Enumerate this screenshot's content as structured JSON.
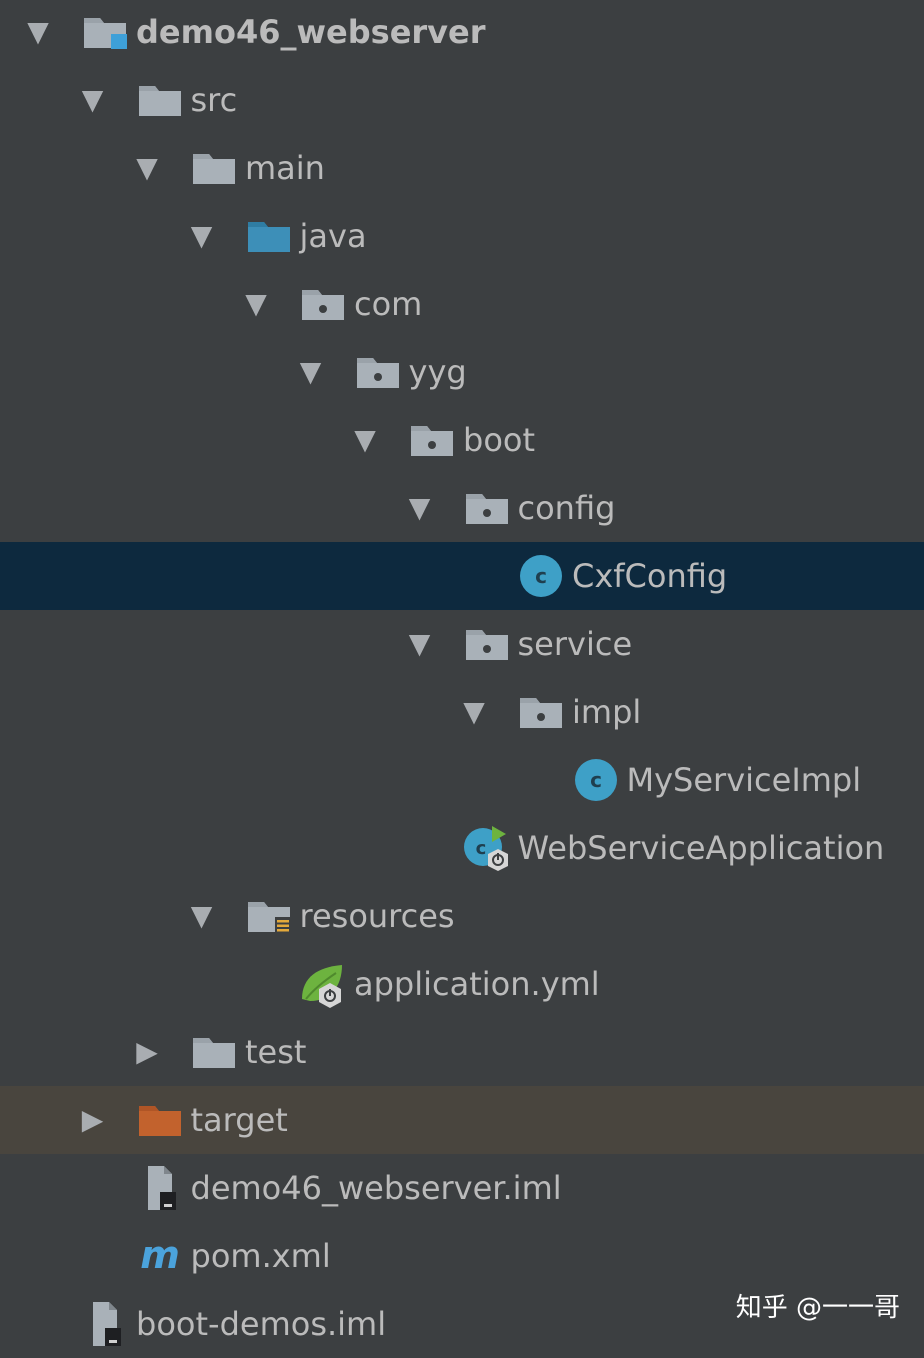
{
  "tree": [
    {
      "id": "demo46",
      "label": "demo46_webserver",
      "indent": 0,
      "arrow": "down",
      "icon": "module-folder-icon",
      "bold": true
    },
    {
      "id": "src",
      "label": "src",
      "indent": 1,
      "arrow": "down",
      "icon": "folder-icon"
    },
    {
      "id": "main",
      "label": "main",
      "indent": 2,
      "arrow": "down",
      "icon": "folder-icon"
    },
    {
      "id": "java",
      "label": "java",
      "indent": 3,
      "arrow": "down",
      "icon": "source-folder-icon"
    },
    {
      "id": "com",
      "label": "com",
      "indent": 4,
      "arrow": "down",
      "icon": "package-icon"
    },
    {
      "id": "yyg",
      "label": "yyg",
      "indent": 5,
      "arrow": "down",
      "icon": "package-icon"
    },
    {
      "id": "boot",
      "label": "boot",
      "indent": 6,
      "arrow": "down",
      "icon": "package-icon"
    },
    {
      "id": "config",
      "label": "config",
      "indent": 7,
      "arrow": "down",
      "icon": "package-icon"
    },
    {
      "id": "cxfconfig",
      "label": "CxfConfig",
      "indent": 8,
      "arrow": "none",
      "icon": "class-icon",
      "state": "selected"
    },
    {
      "id": "service",
      "label": "service",
      "indent": 7,
      "arrow": "down",
      "icon": "package-icon"
    },
    {
      "id": "impl",
      "label": "impl",
      "indent": 8,
      "arrow": "down",
      "icon": "package-icon"
    },
    {
      "id": "myserviceimpl",
      "label": "MyServiceImpl",
      "indent": 9,
      "arrow": "none",
      "icon": "class-icon"
    },
    {
      "id": "webserviceapplication",
      "label": "WebServiceApplication",
      "indent": 7,
      "arrow": "none",
      "icon": "spring-boot-class-icon"
    },
    {
      "id": "resources",
      "label": "resources",
      "indent": 3,
      "arrow": "down",
      "icon": "resources-folder-icon"
    },
    {
      "id": "applicationyml",
      "label": "application.yml",
      "indent": 4,
      "arrow": "none",
      "icon": "spring-yml-icon"
    },
    {
      "id": "test",
      "label": "test",
      "indent": 2,
      "arrow": "right",
      "icon": "folder-icon"
    },
    {
      "id": "target",
      "label": "target",
      "indent": 1,
      "arrow": "right",
      "icon": "excluded-folder-icon",
      "state": "highlighted"
    },
    {
      "id": "demo46iml",
      "label": "demo46_webserver.iml",
      "indent": 1,
      "arrow": "none",
      "icon": "iml-file-icon"
    },
    {
      "id": "pomxml",
      "label": "pom.xml",
      "indent": 1,
      "arrow": "none",
      "icon": "maven-icon"
    },
    {
      "id": "bootdemosiml",
      "label": "boot-demos.iml",
      "indent": 0,
      "arrow": "none",
      "icon": "iml-file-icon"
    }
  ],
  "watermark": "知乎 @一一哥",
  "colors": {
    "background": "#3c3f41",
    "selected": "#0d293e",
    "highlighted": "#49453e",
    "text": "#bbbbbb",
    "folder": "#a9b1b8",
    "source_folder": "#3d8fb8",
    "excluded_folder": "#c2622d",
    "class_icon": "#3ea0c7",
    "spring": "#6db33f"
  }
}
